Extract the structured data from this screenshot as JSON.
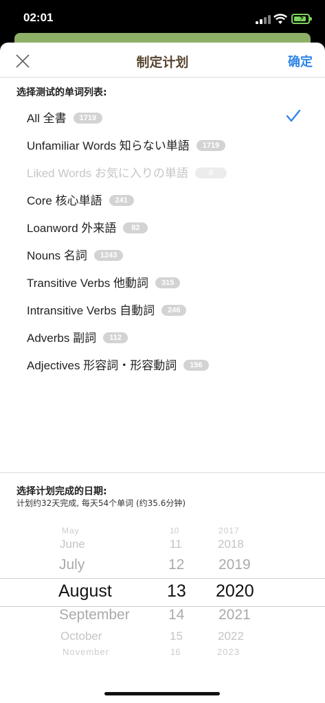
{
  "status_bar": {
    "time": "02:01",
    "battery_charging": true,
    "battery_color": "#7dd35f"
  },
  "nav": {
    "title": "制定计划",
    "confirm_label": "确定",
    "close_icon": "close-icon"
  },
  "word_lists": {
    "section_label": "选择测试的单词列表:",
    "selected_index": 0,
    "items": [
      {
        "label": "All 全書",
        "count": "1719",
        "enabled": true
      },
      {
        "label": "Unfamiliar Words 知らない単語",
        "count": "1719",
        "enabled": true
      },
      {
        "label": "Liked Words お気に入りの単語",
        "count": "0",
        "enabled": false
      },
      {
        "label": "Core 核心単語",
        "count": "241",
        "enabled": true
      },
      {
        "label": "Loanword 外来語",
        "count": "82",
        "enabled": true
      },
      {
        "label": "Nouns 名詞",
        "count": "1243",
        "enabled": true
      },
      {
        "label": "Transitive Verbs 他動詞",
        "count": "315",
        "enabled": true
      },
      {
        "label": "Intransitive Verbs 自動詞",
        "count": "246",
        "enabled": true
      },
      {
        "label": "Adverbs 副詞",
        "count": "112",
        "enabled": true
      },
      {
        "label": "Adjectives 形容詞・形容動詞",
        "count": "156",
        "enabled": true
      }
    ]
  },
  "date_section": {
    "label": "选择计划完成的日期:",
    "summary": "计划约32天完成, 每天54个单词 (约35.6分钟)"
  },
  "date_picker": {
    "months": [
      "May",
      "June",
      "July",
      "August",
      "September",
      "October",
      "November"
    ],
    "days": [
      "10",
      "11",
      "12",
      "13",
      "14",
      "15",
      "16"
    ],
    "years": [
      "2017",
      "2018",
      "2019",
      "2020",
      "2021",
      "2022",
      "2023"
    ],
    "selected": {
      "month": "August",
      "day": "13",
      "year": "2020"
    }
  },
  "colors": {
    "accent": "#2f84e8",
    "title_brown": "#5a4632",
    "badge_gray": "#d3d3d3",
    "header_green": "#8eb067"
  }
}
